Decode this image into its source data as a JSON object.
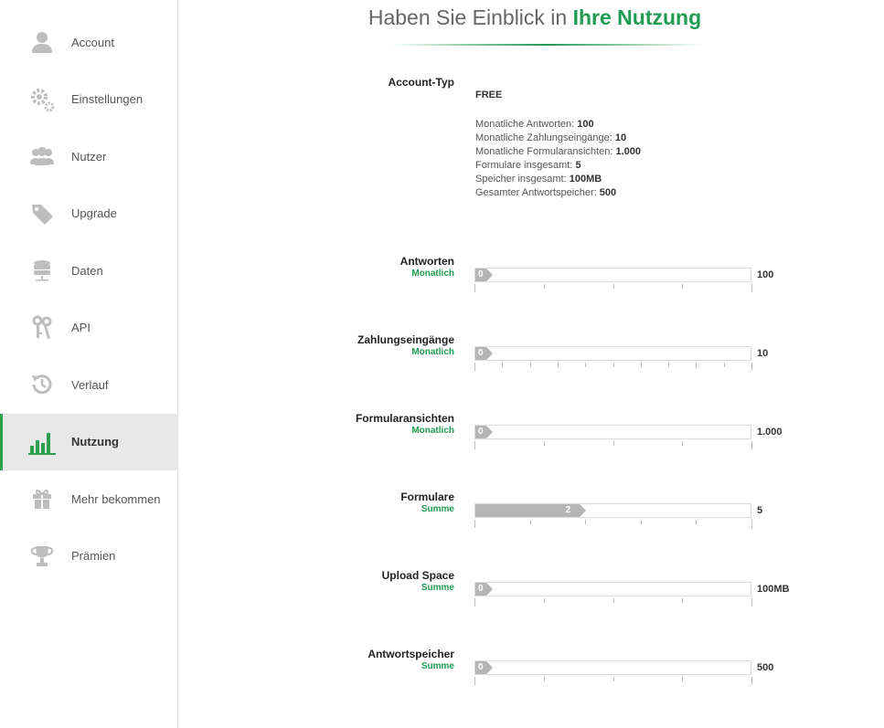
{
  "sidebar": {
    "items": [
      {
        "label": "Account",
        "icon": "user-icon",
        "active": false
      },
      {
        "label": "Einstellungen",
        "icon": "gears-icon",
        "active": false
      },
      {
        "label": "Nutzer",
        "icon": "users-icon",
        "active": false
      },
      {
        "label": "Upgrade",
        "icon": "tag-icon",
        "active": false
      },
      {
        "label": "Daten",
        "icon": "database-icon",
        "active": false
      },
      {
        "label": "API",
        "icon": "keys-icon",
        "active": false
      },
      {
        "label": "Verlauf",
        "icon": "history-icon",
        "active": false
      },
      {
        "label": "Nutzung",
        "icon": "bar-chart-icon",
        "active": true
      },
      {
        "label": "Mehr bekommen",
        "icon": "gift-icon",
        "active": false
      },
      {
        "label": "Prämien",
        "icon": "trophy-icon",
        "active": false
      }
    ]
  },
  "header": {
    "title_part1": "Haben Sie Einblick in ",
    "title_part2": "Ihre Nutzung"
  },
  "account": {
    "label": "Account-Typ",
    "type": "FREE",
    "lines": [
      {
        "label": "Monatliche Antworten: ",
        "value": "100"
      },
      {
        "label": "Monatliche Zahlungseingänge: ",
        "value": "10"
      },
      {
        "label": "Monatliche Formularansichten: ",
        "value": "1.000"
      },
      {
        "label": "Formulare insgesamt: ",
        "value": "5"
      },
      {
        "label": "Speicher insgesamt: ",
        "value": "100MB"
      },
      {
        "label": "Gesamter Antwortspeicher: ",
        "value": "500"
      }
    ]
  },
  "usage": [
    {
      "label": "Antworten",
      "sub": "Monatlich",
      "used": "0",
      "limit": "100",
      "fraction": 0,
      "ticks": 4
    },
    {
      "label": "Zahlungseingänge",
      "sub": "Monatlich",
      "used": "0",
      "limit": "10",
      "fraction": 0,
      "ticks": 10
    },
    {
      "label": "Formularansichten",
      "sub": "Monatlich",
      "used": "0",
      "limit": "1.000",
      "fraction": 0,
      "ticks": 4
    },
    {
      "label": "Formulare",
      "sub": "Summe",
      "used": "2",
      "limit": "5",
      "fraction": 0.4,
      "ticks": 5
    },
    {
      "label": "Upload Space",
      "sub": "Summe",
      "used": "0",
      "limit": "100MB",
      "fraction": 0,
      "ticks": 4
    },
    {
      "label": "Antwortspeicher",
      "sub": "Summe",
      "used": "0",
      "limit": "500",
      "fraction": 0,
      "ticks": 4
    }
  ],
  "colors": {
    "accent": "#1f9b52",
    "bar_fill": "#b5b5b5"
  }
}
